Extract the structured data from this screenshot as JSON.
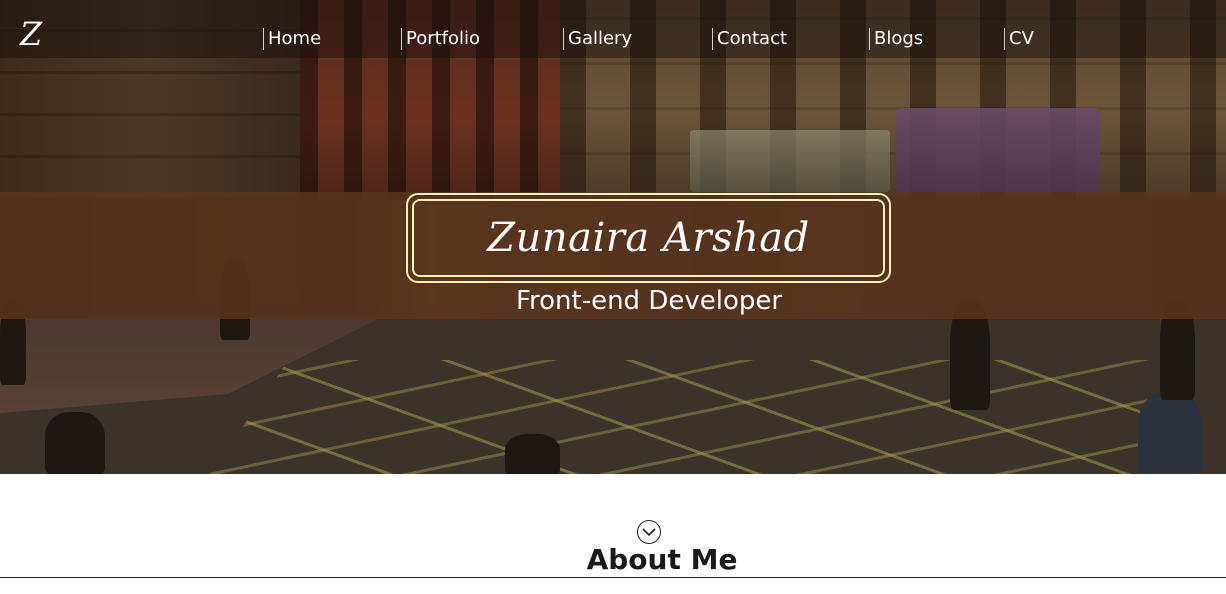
{
  "header": {
    "logo_text": "Z",
    "nav_items": [
      {
        "label": "Home"
      },
      {
        "label": "Portfolio"
      },
      {
        "label": "Gallery"
      },
      {
        "label": "Contact"
      },
      {
        "label": "Blogs"
      },
      {
        "label": "CV"
      }
    ]
  },
  "hero": {
    "name": "Zunaira Arshad",
    "role": "Front-end Developer",
    "accent_color": "#f6f2b0",
    "band_color": "#5a361e"
  },
  "about": {
    "scroll_icon": "chevron-down-circle-icon",
    "heading": "About Me"
  }
}
